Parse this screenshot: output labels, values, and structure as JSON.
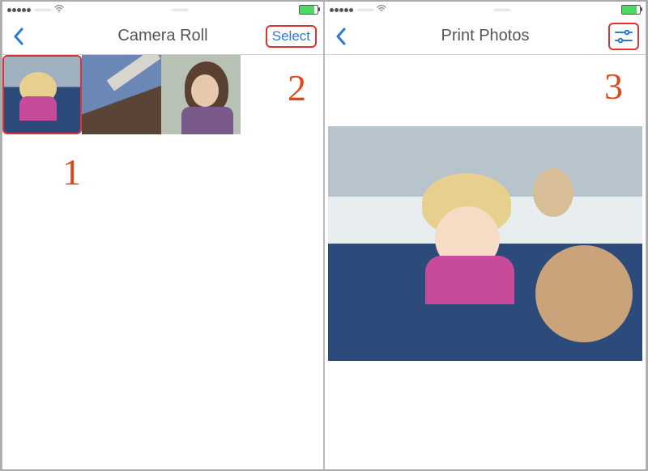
{
  "annotations": {
    "one": "1",
    "two": "2",
    "three": "3"
  },
  "colors": {
    "accent": "#2a7ad6",
    "highlight": "#d33",
    "annotation": "#e04a1a"
  },
  "left_screen": {
    "statusbar": {
      "carrier_blur": "——",
      "time_blur": "——",
      "battery_pct": 80
    },
    "nav": {
      "title": "Camera Roll",
      "action": "Select"
    },
    "thumbnails": [
      {
        "name": "photo-girl-on-bus",
        "selected": true
      },
      {
        "name": "photo-bridge",
        "selected": false
      },
      {
        "name": "photo-woman-portrait",
        "selected": false
      }
    ]
  },
  "right_screen": {
    "statusbar": {
      "carrier_blur": "——",
      "time_blur": "——",
      "battery_pct": 80
    },
    "nav": {
      "title": "Print Photos",
      "settings_icon": "sliders-icon"
    },
    "preview_photo": "photo-girl-on-bus"
  }
}
